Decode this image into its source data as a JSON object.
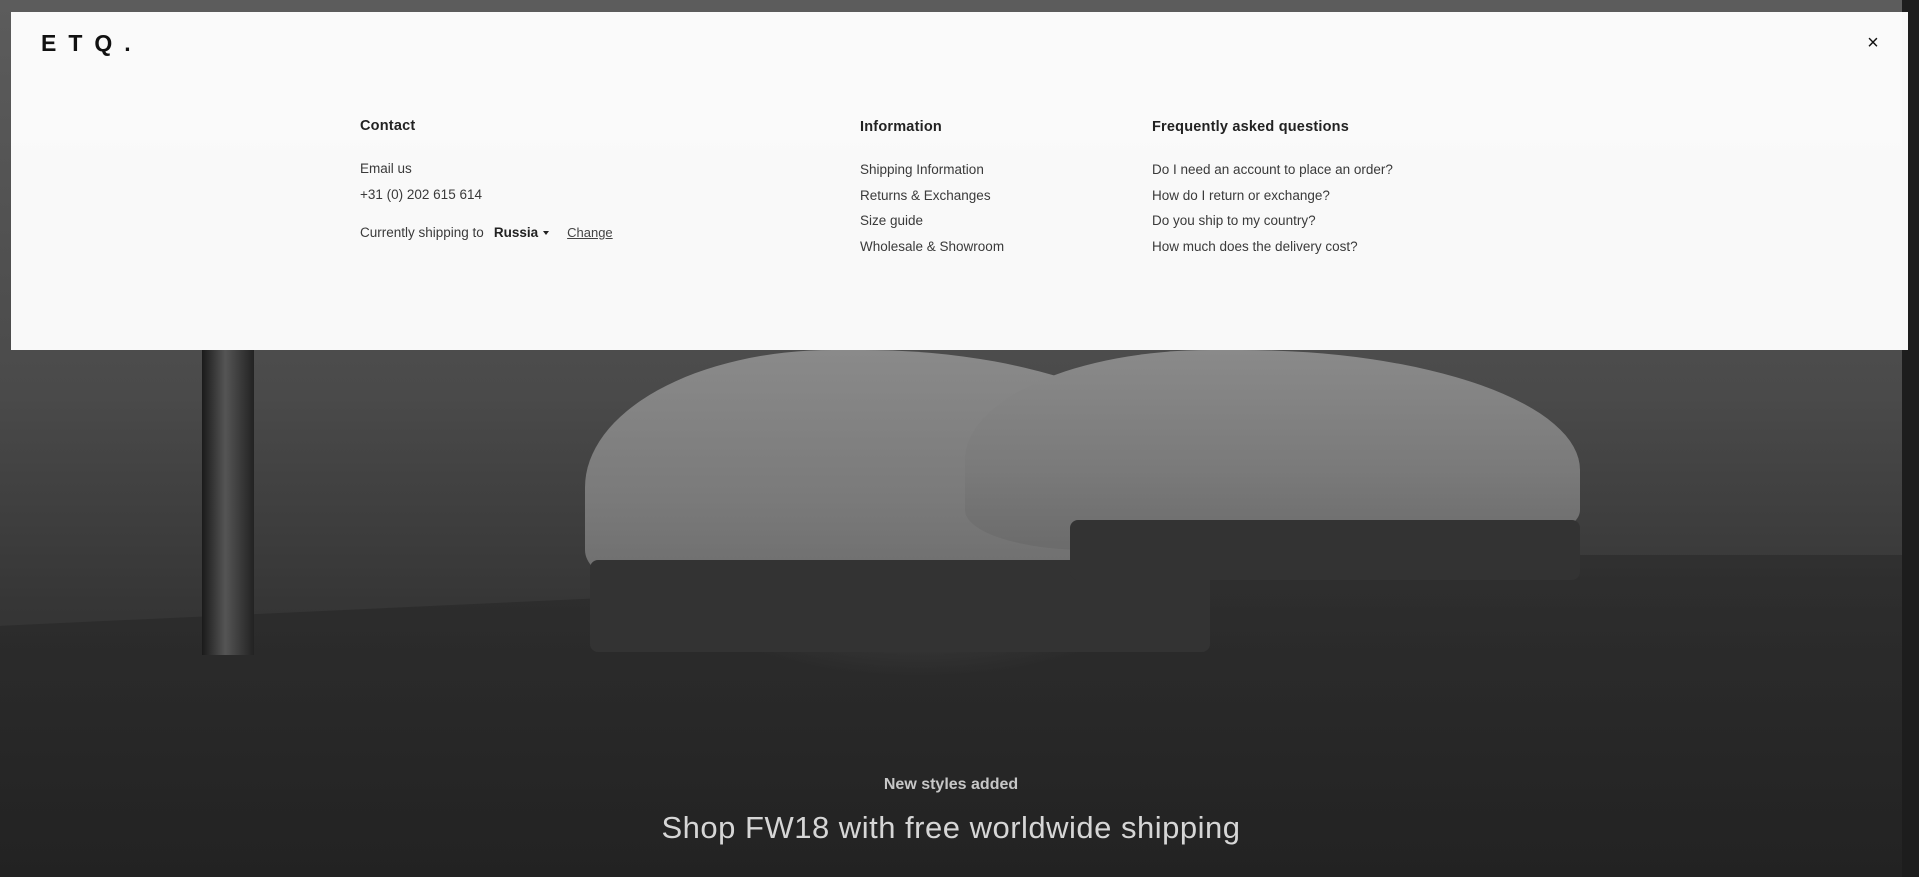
{
  "hero": {
    "kicker": "New styles added",
    "headline": "Shop FW18 with free worldwide shipping"
  },
  "menu": {
    "logo": "ETQ.",
    "close_icon": "×",
    "contact": {
      "title": "Contact",
      "email_label": "Email us",
      "phone": "+31 (0) 202 615 614",
      "shipping_label": "Currently shipping to",
      "country": "Russia",
      "change_label": "Change"
    },
    "information": {
      "title": "Information",
      "links": [
        "Shipping Information",
        "Returns & Exchanges",
        "Size guide",
        "Wholesale & Showroom"
      ]
    },
    "faq": {
      "title": "Frequently asked questions",
      "links": [
        "Do I need an account to place an order?",
        "How do I return or exchange?",
        "Do you ship to my country?",
        "How much does the delivery cost?"
      ]
    }
  },
  "colors": {
    "panel_bg": "#ffffff",
    "text": "#333333",
    "hero_dark": "#2f2f2f"
  }
}
